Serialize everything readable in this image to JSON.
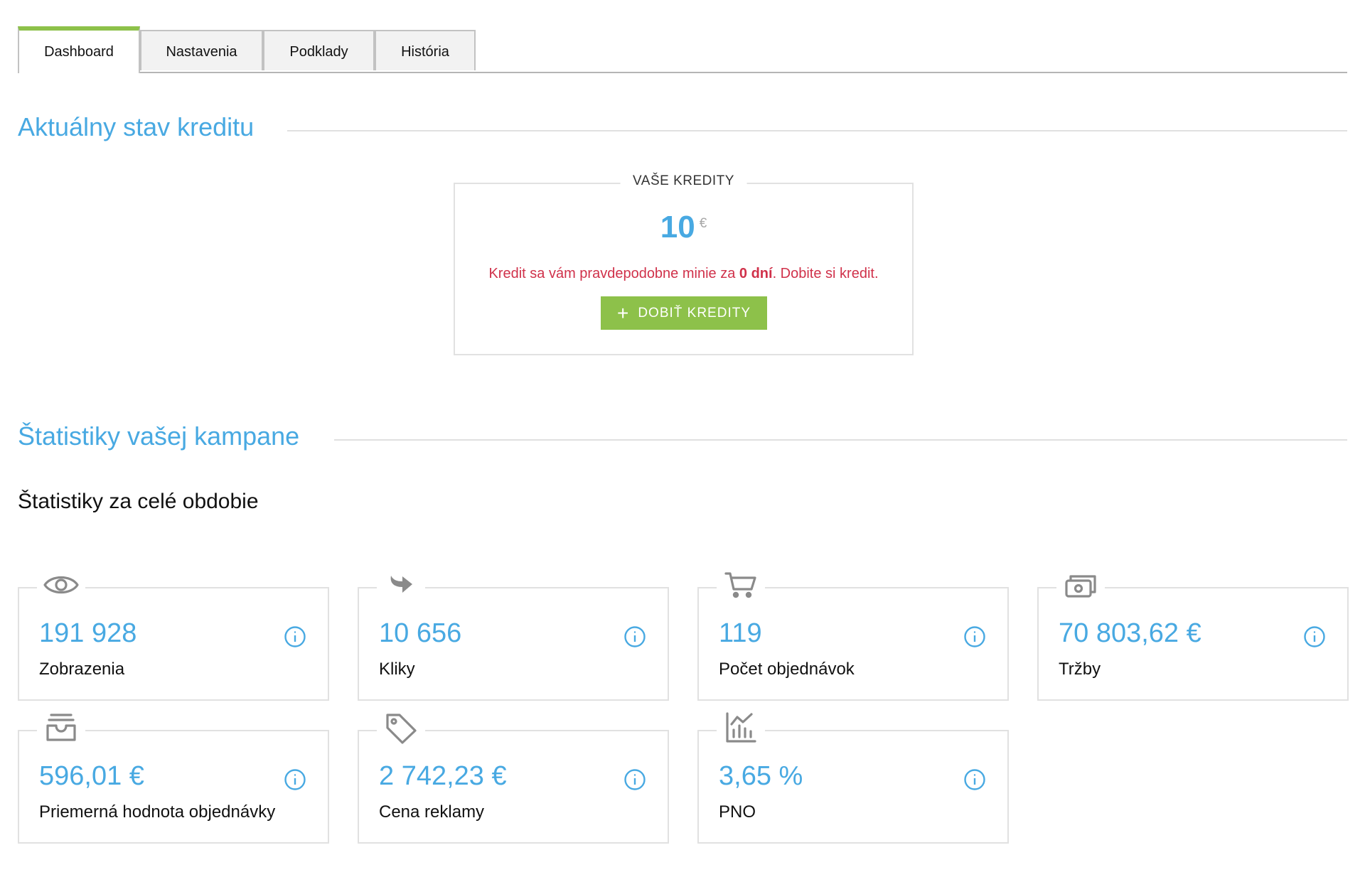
{
  "tabs": [
    {
      "label": "Dashboard",
      "active": true
    },
    {
      "label": "Nastavenia",
      "active": false
    },
    {
      "label": "Podklady",
      "active": false
    },
    {
      "label": "História",
      "active": false
    }
  ],
  "credit_section": {
    "heading": "Aktuálny stav kreditu",
    "box_title": "VAŠE KREDITY",
    "amount": "10",
    "currency": "€",
    "warning_prefix": "Kredit sa vám pravdepodobne minie za ",
    "warning_days": "0 dní",
    "warning_suffix": ". Dobite si kredit.",
    "button_icon": "+",
    "button_label": "DOBIŤ KREDITY"
  },
  "stats_section": {
    "heading": "Štatistiky vašej kampane",
    "subheading": "Štatistiky za celé obdobie",
    "cards": [
      {
        "icon": "eye-icon",
        "value": "191 928",
        "label": "Zobrazenia"
      },
      {
        "icon": "redirect-arrow-icon",
        "value": "10 656",
        "label": "Kliky"
      },
      {
        "icon": "cart-icon",
        "value": "119",
        "label": "Počet objednávok"
      },
      {
        "icon": "cash-icon",
        "value": "70 803,62 €",
        "label": "Tržby"
      },
      {
        "icon": "inbox-icon",
        "value": "596,01 €",
        "label": "Priemerná hodnota objednávky"
      },
      {
        "icon": "tag-icon",
        "value": "2 742,23 €",
        "label": "Cena reklamy"
      },
      {
        "icon": "analytics-chart-icon",
        "value": "3,65 %",
        "label": "PNO"
      }
    ]
  },
  "colors": {
    "accent_blue": "#48a9e2",
    "accent_green": "#8dc14a",
    "warning_red": "#d0314a"
  }
}
